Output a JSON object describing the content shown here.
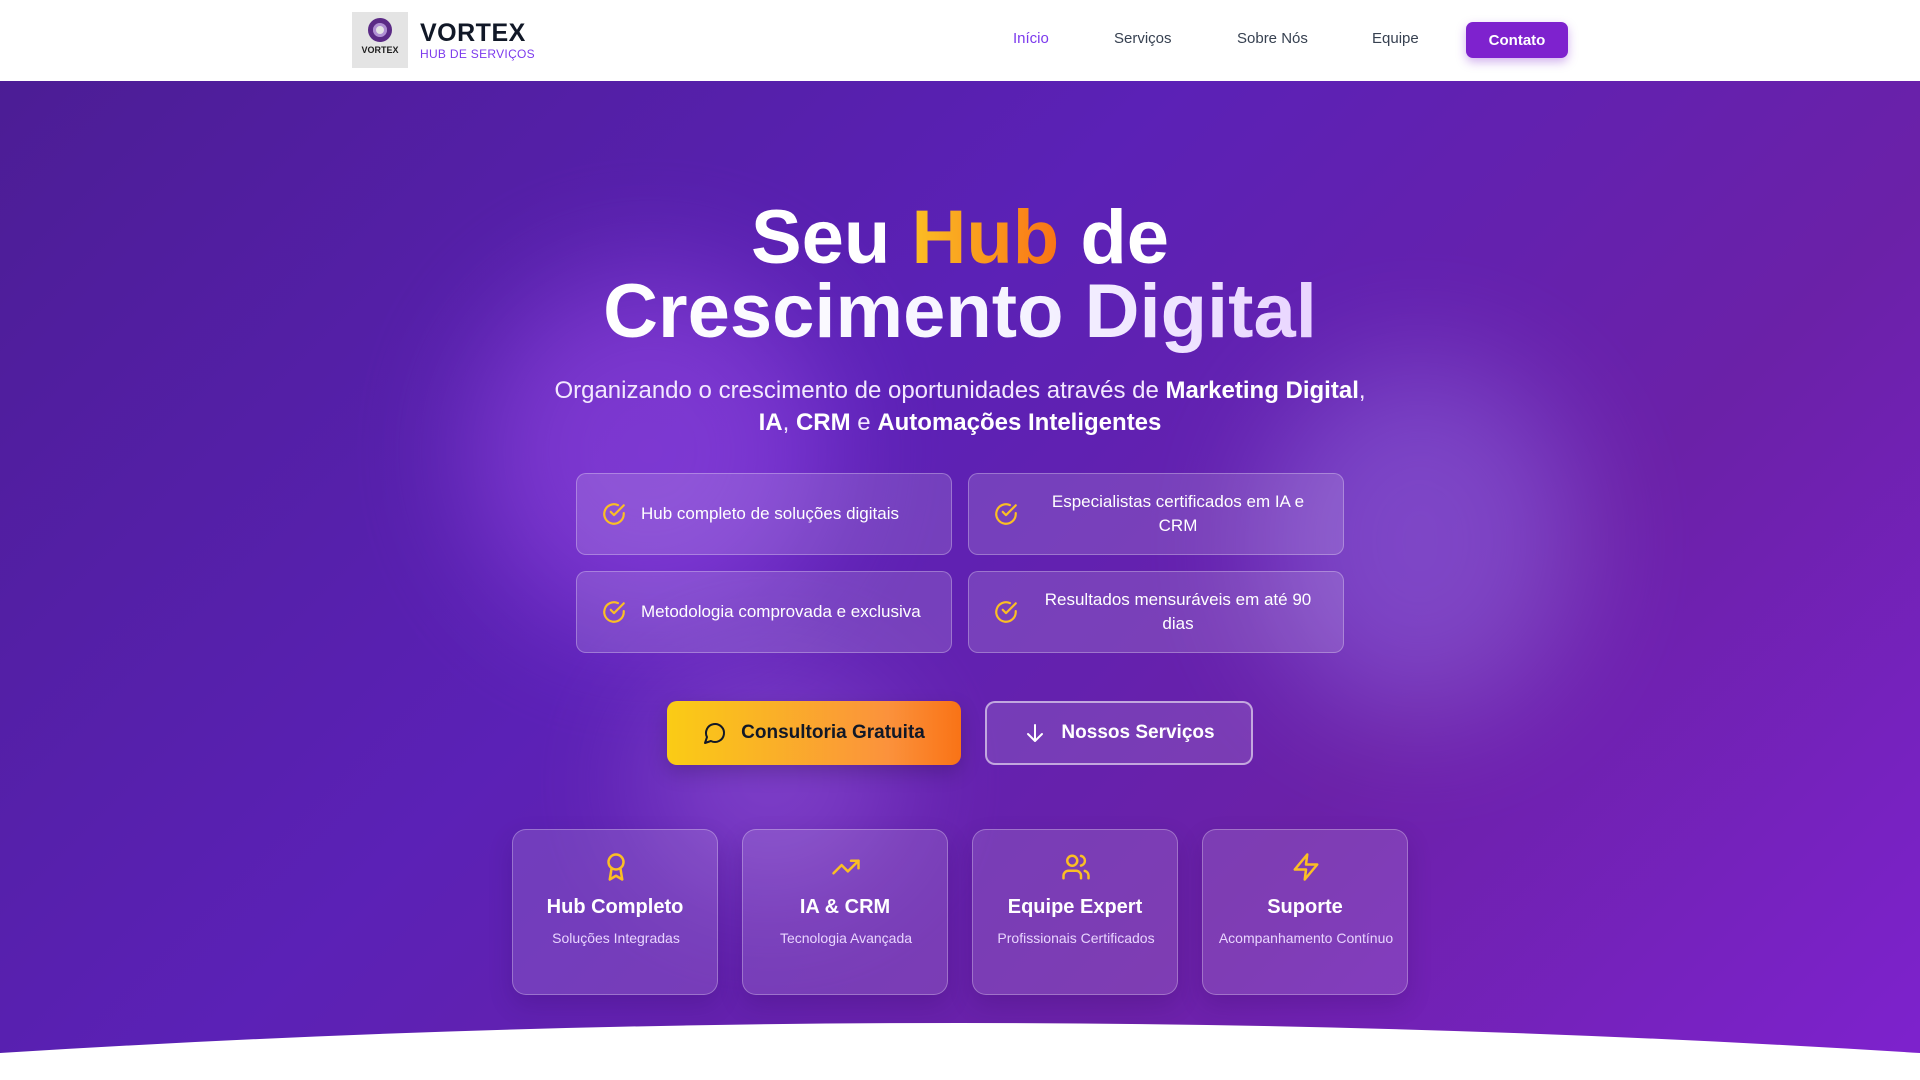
{
  "brand": {
    "logo_text": "VORTEX",
    "name": "VORTEX",
    "tagline": "HUB DE SERVIÇOS"
  },
  "nav": {
    "items": [
      {
        "label": "Início",
        "active": true
      },
      {
        "label": "Serviços",
        "active": false
      },
      {
        "label": "Sobre Nós",
        "active": false
      },
      {
        "label": "Equipe",
        "active": false
      }
    ],
    "contact_label": "Contato"
  },
  "hero": {
    "title_part1": "Seu ",
    "title_accent": "Hub",
    "title_part2": " de",
    "title_line2": "Crescimento Digital",
    "subtitle_intro": "Organizando o crescimento de oportunidades através de ",
    "subtitle_b1": "Marketing Digital",
    "subtitle_sep1": ",",
    "subtitle_b2": "IA",
    "subtitle_sep2": ", ",
    "subtitle_b3": "CRM",
    "subtitle_sep3": " e ",
    "subtitle_b4": "Automações Inteligentes",
    "features": [
      "Hub completo de soluções digitais",
      "Especialistas certificados em IA e CRM",
      "Metodologia comprovada e exclusiva",
      "Resultados mensuráveis em até 90 dias"
    ],
    "cta_primary": "Consultoria Gratuita",
    "cta_secondary": "Nossos Serviços",
    "cards": [
      {
        "icon": "award-icon",
        "title": "Hub Completo",
        "subtitle": "Soluções Integradas"
      },
      {
        "icon": "trending-up-icon",
        "title": "IA & CRM",
        "subtitle": "Tecnologia Avançada"
      },
      {
        "icon": "users-icon",
        "title": "Equipe Expert",
        "subtitle": "Profissionais Certificados"
      },
      {
        "icon": "lightning-icon",
        "title": "Suporte",
        "subtitle": "Acompanhamento Contínuo"
      }
    ]
  },
  "colors": {
    "brand_purple": "#7e22ce",
    "accent_yellow": "#fbbf24",
    "accent_orange": "#f97316",
    "hero_bg": "#5b21b6"
  }
}
